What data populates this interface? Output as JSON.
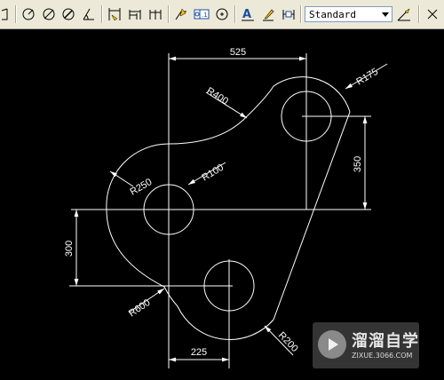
{
  "toolbar": {
    "dimstyle_value": "Standard",
    "buttons": [
      "dimension-ucs-icon",
      "dim-radius-icon",
      "dim-diameter-icon",
      "dim-arc-icon",
      "dim-angular-icon",
      "quick-dimension-icon",
      "dim-baseline-icon",
      "dim-continue-icon",
      "quick-leader-icon",
      "tolerance-icon",
      "center-mark-icon",
      "dim-edit-icon",
      "dim-text-edit-icon",
      "dim-update-icon",
      "dim-style-icon"
    ]
  },
  "drawing": {
    "colors": {
      "background": "#000000",
      "lines": "#ffffff"
    },
    "dimensions": {
      "top_width": "525",
      "right_height": "350",
      "left_height": "300",
      "bottom_width": "225",
      "r400": "R400",
      "r175": "R175",
      "r250": "R250",
      "r100": "R100",
      "r600": "R600",
      "r200": "R200"
    }
  },
  "watermark": {
    "title": "溜溜自学",
    "url": "ZIXUE.3066.COM"
  }
}
